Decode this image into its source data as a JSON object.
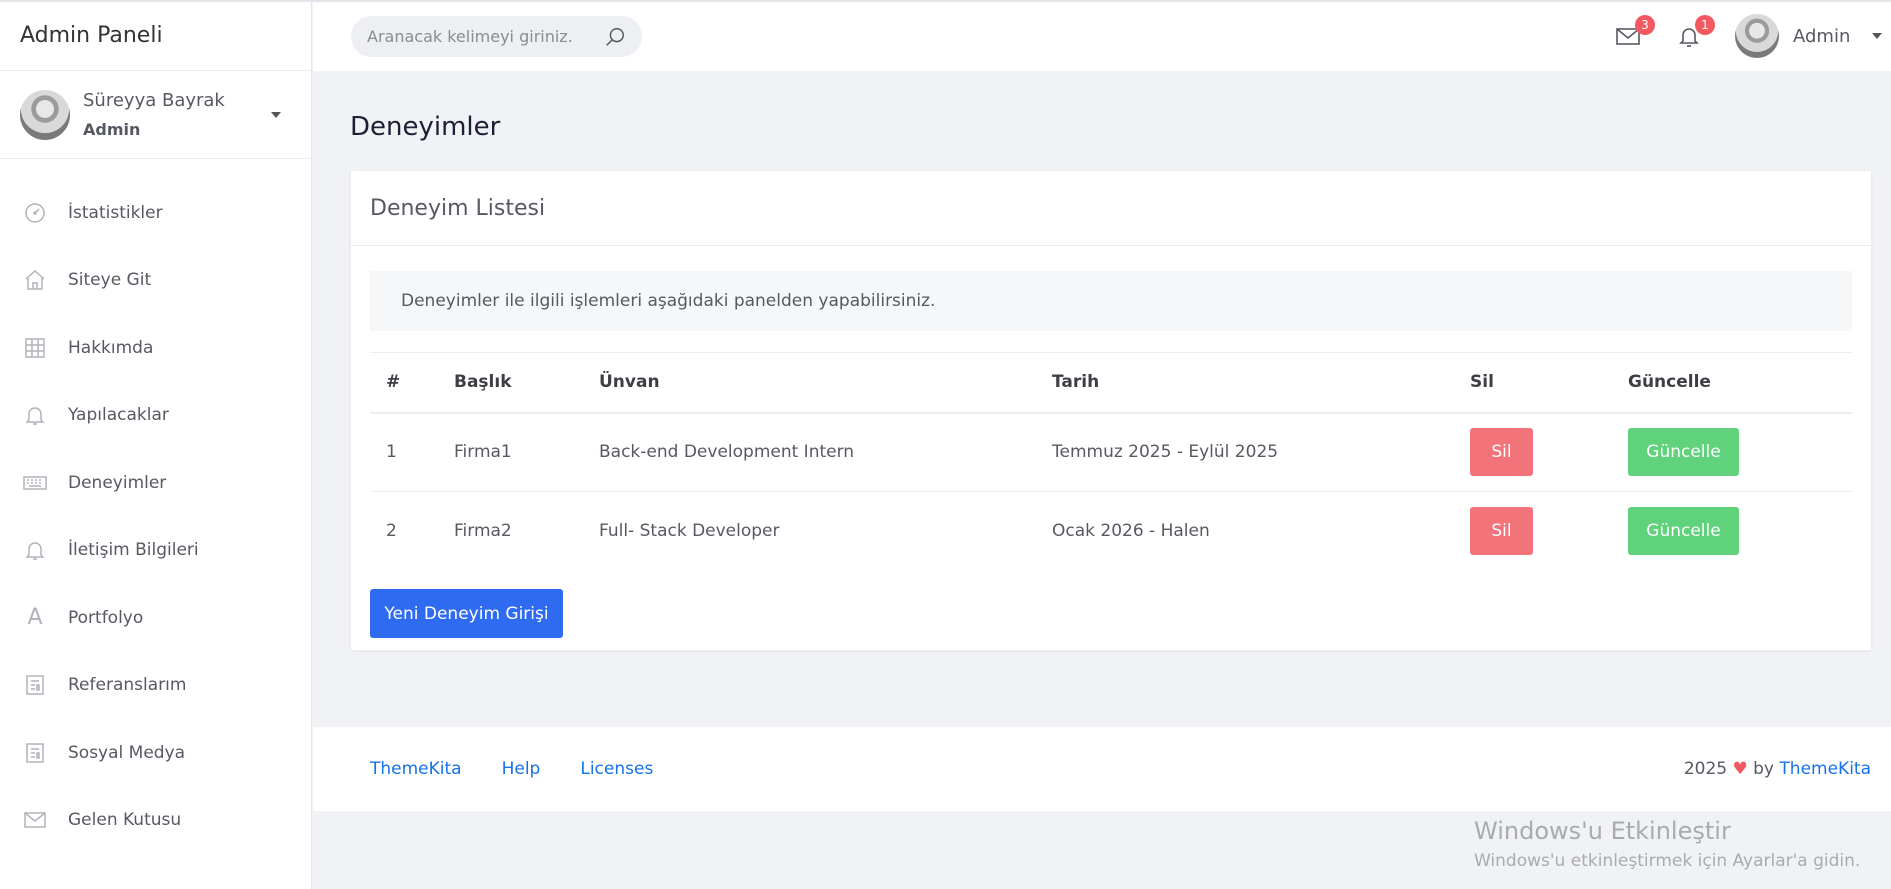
{
  "sidebar": {
    "brand": "Admin Paneli",
    "user": {
      "name": "Süreyya Bayrak",
      "role": "Admin"
    },
    "items": [
      {
        "label": "İstatistikler",
        "icon": "dashboard-gauge-icon"
      },
      {
        "label": "Siteye Git",
        "icon": "home-icon"
      },
      {
        "label": "Hakkımda",
        "icon": "grid-icon"
      },
      {
        "label": "Yapılacaklar",
        "icon": "bell-icon"
      },
      {
        "label": "Deneyimler",
        "icon": "keyboard-icon"
      },
      {
        "label": "İletişim Bilgileri",
        "icon": "bell-icon"
      },
      {
        "label": "Portfolyo",
        "icon": "font-a-icon"
      },
      {
        "label": "Referanslarım",
        "icon": "document-icon"
      },
      {
        "label": "Sosyal Medya",
        "icon": "document-icon"
      },
      {
        "label": "Gelen Kutusu",
        "icon": "envelope-icon"
      }
    ]
  },
  "header": {
    "search_placeholder": "Aranacak kelimeyi giriniz.",
    "mail_count": "3",
    "notification_count": "1",
    "user_name": "Admin"
  },
  "main": {
    "page_title": "Deneyimler",
    "card_title": "Deneyim Listesi",
    "info_text": "Deneyimler ile ilgili işlemleri aşağıdaki panelden yapabilirsiniz.",
    "table": {
      "headers": [
        "#",
        "Başlık",
        "Ünvan",
        "Tarih",
        "Sil",
        "Güncelle"
      ],
      "rows": [
        {
          "no": "1",
          "title": "Firma1",
          "position": "Back-end Development Intern",
          "date": "Temmuz 2025 - Eylül 2025",
          "delete_label": "Sil",
          "update_label": "Güncelle"
        },
        {
          "no": "2",
          "title": "Firma2",
          "position": "Full- Stack Developer",
          "date": "Ocak 2026 - Halen",
          "delete_label": "Sil",
          "update_label": "Güncelle"
        }
      ]
    },
    "new_button": "Yeni Deneyim Girişi"
  },
  "footer": {
    "links": [
      "ThemeKita",
      "Help",
      "Licenses"
    ],
    "copyright_year": "2025",
    "heart": "♥",
    "by": "by",
    "brand_link": "ThemeKita"
  },
  "watermark": {
    "title": "Windows'u Etkinleştir",
    "subtitle": "Windows'u etkinleştirmek için Ayarlar'a gidin."
  },
  "colors": {
    "primary": "#2f6bf0",
    "danger": "#f3737b",
    "success": "#5fd27b",
    "badge": "#f25961",
    "link": "#1572e8"
  }
}
